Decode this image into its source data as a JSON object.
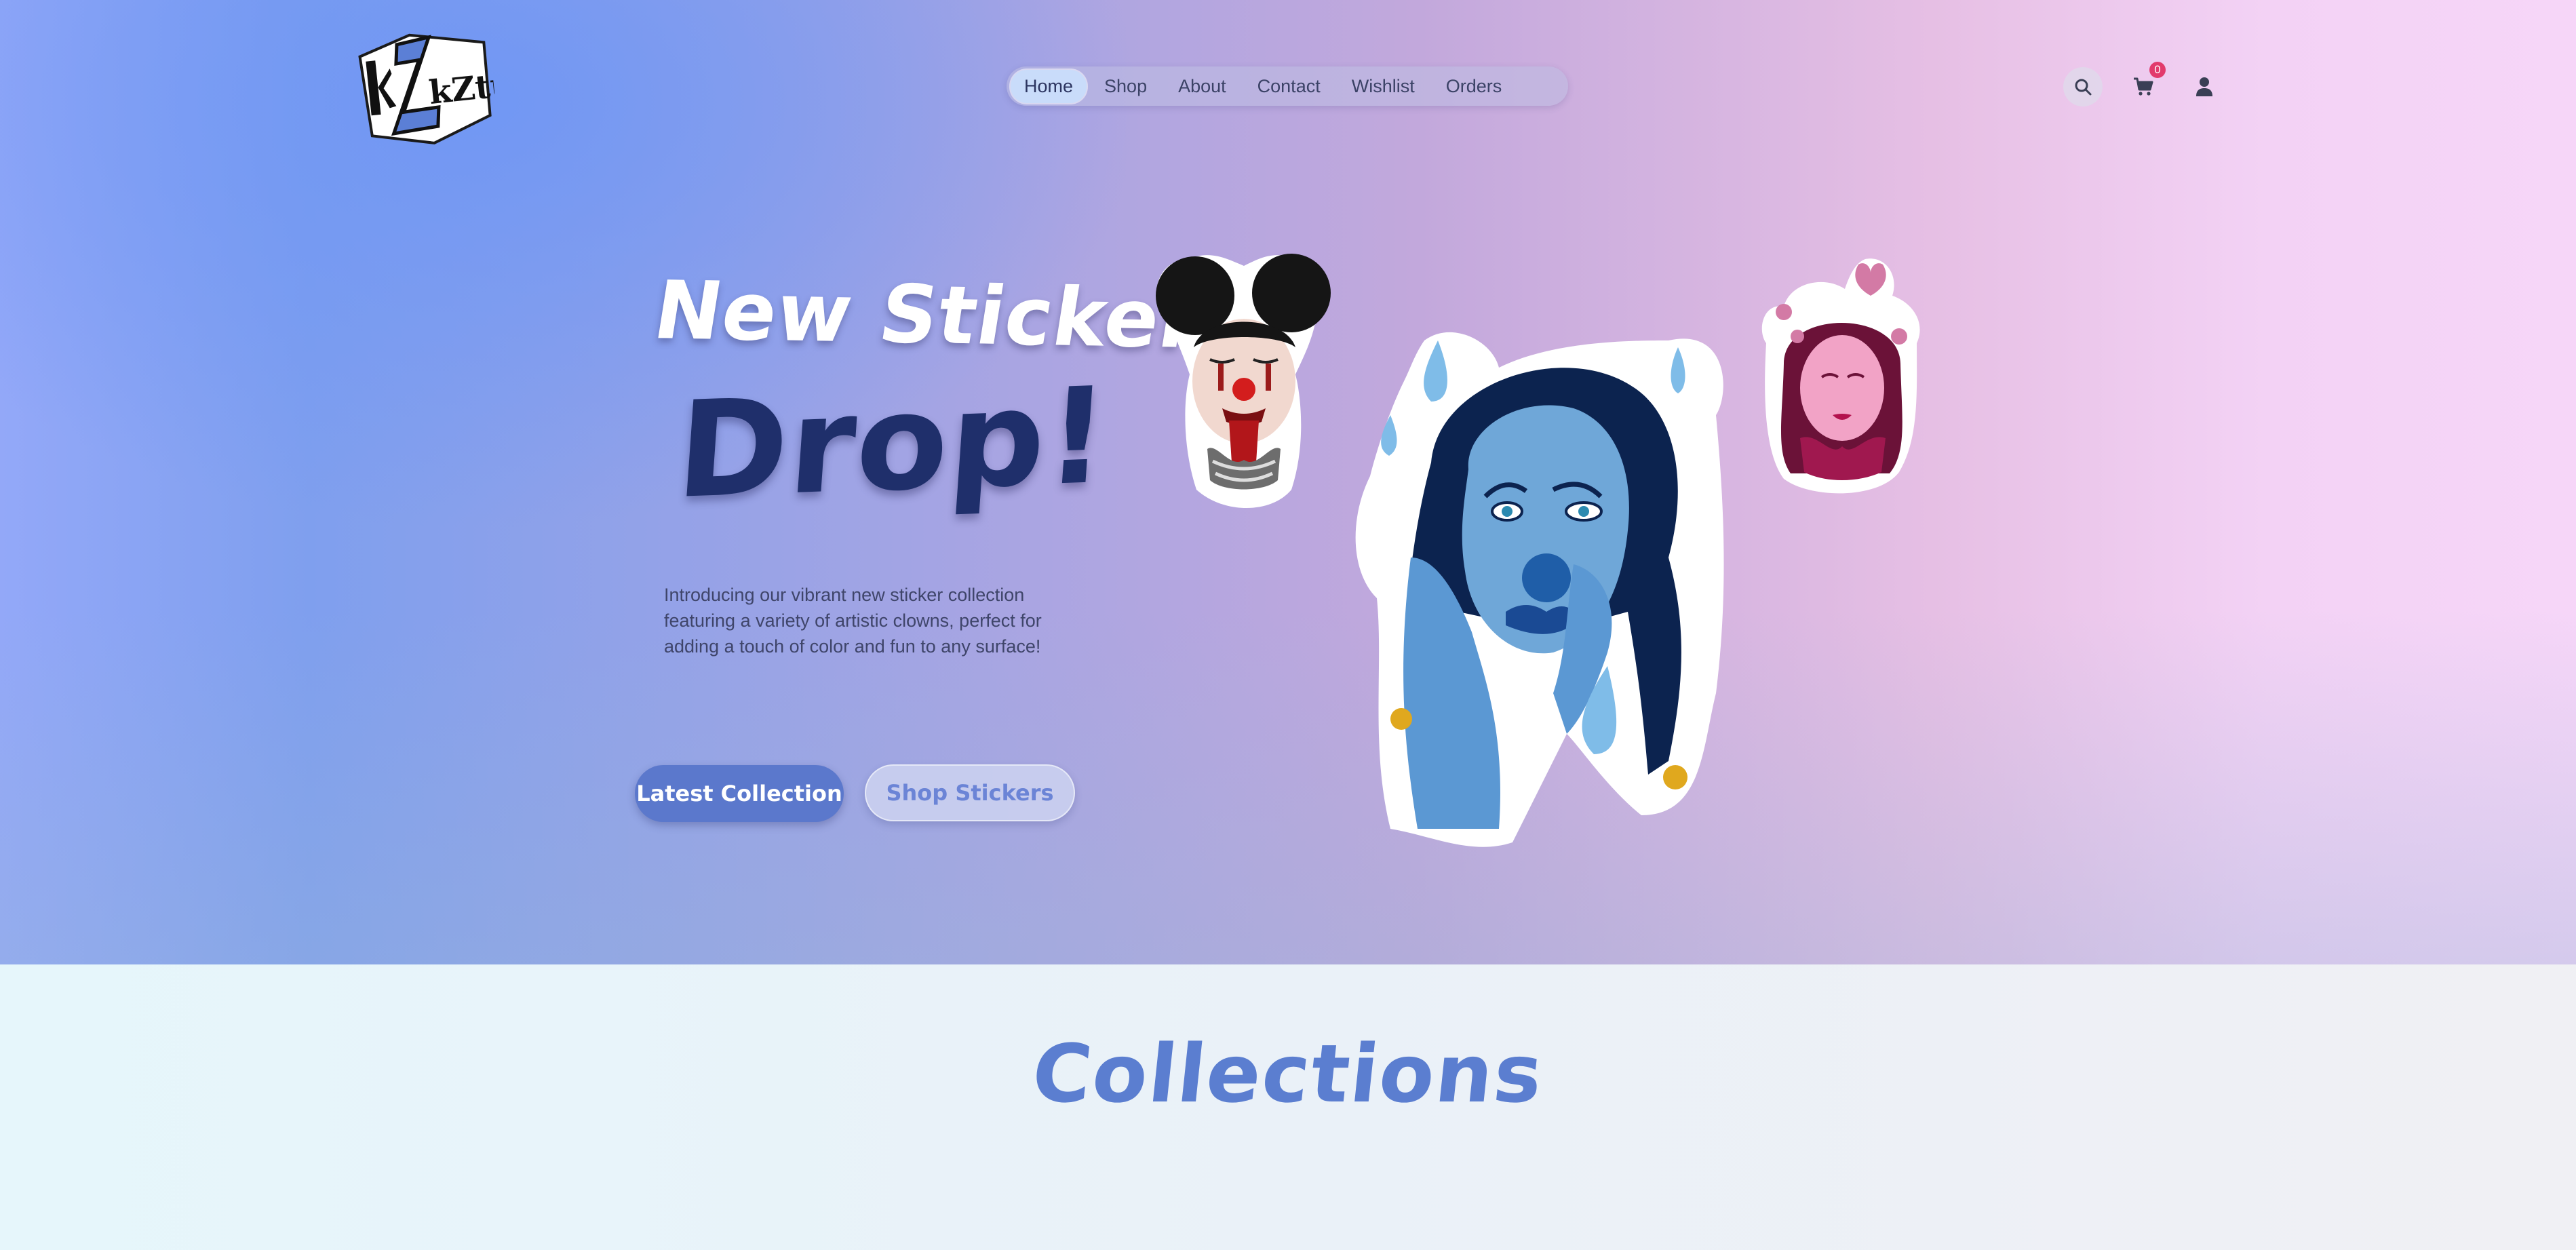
{
  "brand": {
    "logo_text": "kZtudioz"
  },
  "nav": {
    "items": [
      {
        "label": "Home",
        "active": true
      },
      {
        "label": "Shop",
        "active": false
      },
      {
        "label": "About",
        "active": false
      },
      {
        "label": "Contact",
        "active": false
      },
      {
        "label": "Wishlist",
        "active": false
      },
      {
        "label": "Orders",
        "active": false
      }
    ]
  },
  "header_icons": {
    "search": "search-icon",
    "cart": "cart-icon",
    "cart_count": "0",
    "user": "user-icon"
  },
  "hero": {
    "title_line1": "New Sticker",
    "title_line2": "Drop!",
    "description": "Introducing our vibrant new sticker collection featuring a variety of artistic clowns, perfect for adding a touch of color and fun to any surface!",
    "primary_button": "Latest Collection",
    "secondary_button": "Shop Stickers"
  },
  "stickers": [
    {
      "name": "clown-girl-black-puffs-sticker"
    },
    {
      "name": "blue-crying-clown-sticker"
    },
    {
      "name": "pink-clown-girl-sticker"
    }
  ],
  "collections": {
    "title": "Collections"
  },
  "colors": {
    "accent": "#5b78cc",
    "title_dark": "#1f2f6b",
    "badge": "#e23a6c"
  }
}
